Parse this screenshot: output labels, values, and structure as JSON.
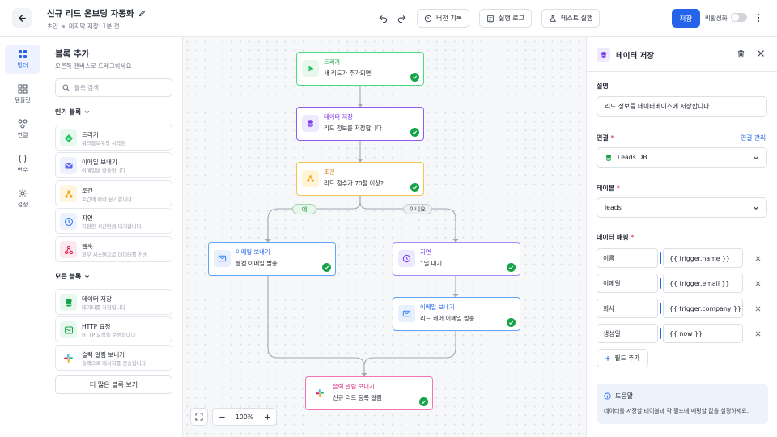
{
  "header": {
    "title": "신규 리드 온보딩 자동화",
    "status": "초안",
    "last_saved": "마지막 저장: 1분 전",
    "version_history": "버전 기록",
    "run_log": "실행 로그",
    "test_run": "테스트 실행",
    "save": "저장",
    "deactivate": "비활성화"
  },
  "rail": {
    "builder": "빌더",
    "templates": "템플릿",
    "connections": "연결",
    "variables": "변수",
    "settings": "설정"
  },
  "blocks_panel": {
    "title": "블록 추가",
    "subtitle": "오른쪽 캔버스로 드래그하세요",
    "search_placeholder": "블록 검색",
    "popular_heading": "인기 블록",
    "all_heading": "모든 블록",
    "more_button": "더 많은 블록 보기",
    "popular": [
      {
        "name": "트리거",
        "desc": "워크플로우의 시작점"
      },
      {
        "name": "이메일 보내기",
        "desc": "이메일을 발송합니다"
      },
      {
        "name": "조건",
        "desc": "조건에 따라 분기합니다"
      },
      {
        "name": "지연",
        "desc": "지정한 시간만큼 대기합니다"
      },
      {
        "name": "웹훅",
        "desc": "외부 시스템으로 데이터를 전송"
      }
    ],
    "all": [
      {
        "name": "데이터 저장",
        "desc": "데이터를 저장합니다"
      },
      {
        "name": "HTTP 요청",
        "desc": "HTTP 요청을 수행합니다"
      },
      {
        "name": "슬랙 알림 보내기",
        "desc": "슬랙으로 메시지를 전송합니다"
      }
    ]
  },
  "canvas": {
    "nodes": {
      "trigger": {
        "title": "트리거",
        "desc": "새 리드가 추가되면"
      },
      "save": {
        "title": "데이터 저장",
        "desc": "리드 정보를 저장합니다"
      },
      "condition": {
        "title": "조건",
        "desc": "리드 점수가 70점 이상?"
      },
      "email1": {
        "title": "이메일 보내기",
        "desc": "웰컴 이메일 발송"
      },
      "delay": {
        "title": "지연",
        "desc": "1일 대기"
      },
      "email2": {
        "title": "이메일 보내기",
        "desc": "리드 케어 이메일 발송"
      },
      "slack": {
        "title": "슬랙 알림 보내기",
        "desc": "신규 리드 등록 알림"
      }
    },
    "branch_yes": "예",
    "branch_no": "아니요",
    "zoom": "100%"
  },
  "properties": {
    "title": "데이터 저장",
    "description_label": "설명",
    "description_value": "리드 정보를 데이터베이스에 저장합니다",
    "connection_label": "연결",
    "manage_connections": "연결 관리",
    "connection_value": "Leads DB",
    "table_label": "테이블",
    "table_value": "leads",
    "mapping_label": "데이터 매핑",
    "mappings": [
      {
        "field": "이름",
        "value": "{{ trigger.name }}"
      },
      {
        "field": "이메일",
        "value": "{{ trigger.email }}"
      },
      {
        "field": "회사",
        "value": "{{ trigger.company }}"
      },
      {
        "field": "생성일",
        "value": "{{ now }}"
      }
    ],
    "add_field": "필드 추가",
    "help_title": "도움말",
    "help_body": "데이터를 저장할 테이블과 각 필드에 매핑할 값을 설정하세요."
  },
  "colors": {
    "accent": "#2563eb",
    "trigger": "#22c55e",
    "save": "#8b5cf6",
    "condition": "#f5b942",
    "email": "#3b82f6",
    "delay": "#8b5cf6",
    "slack": "#ec4899",
    "success": "#16a34a"
  }
}
